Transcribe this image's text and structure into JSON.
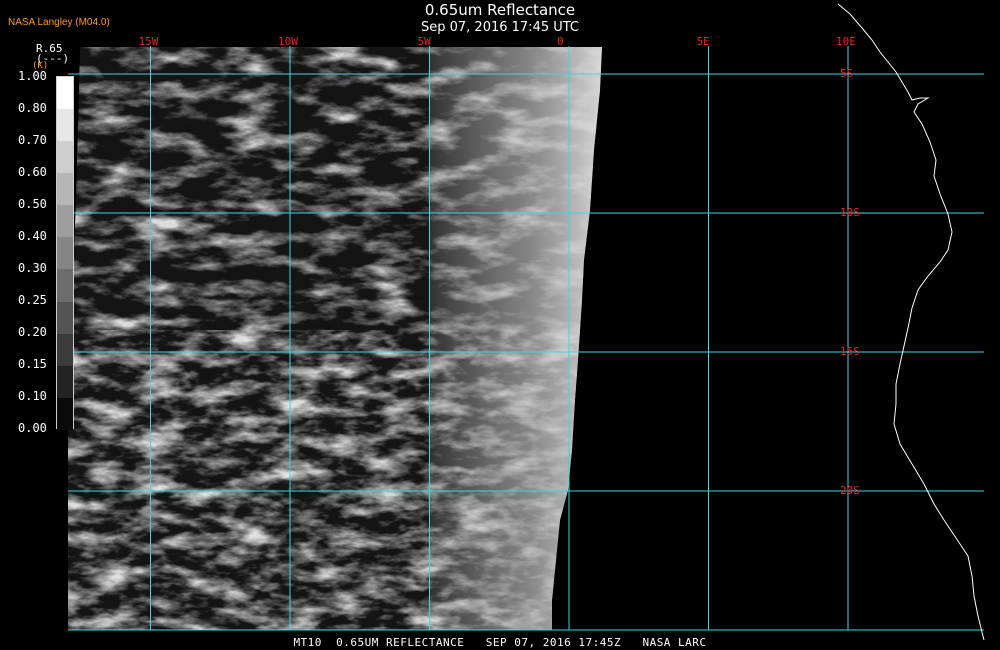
{
  "header": {
    "title": "0.65um Reflectance",
    "subtitle": "Sep 07, 2016 17:45 UTC",
    "producer": "NASA Langley (M04.0)"
  },
  "legend": {
    "variable": "R.65",
    "unit_line": "(---)",
    "unit": "(K)",
    "levels": [
      "1.00",
      "0.80",
      "0.70",
      "0.60",
      "0.50",
      "0.40",
      "0.30",
      "0.25",
      "0.20",
      "0.15",
      "0.10",
      "0.00"
    ]
  },
  "grid": {
    "longitudes": [
      {
        "label": "15W",
        "value": -15
      },
      {
        "label": "10W",
        "value": -10
      },
      {
        "label": "5W",
        "value": -5
      },
      {
        "label": "0",
        "value": 0
      },
      {
        "label": "5E",
        "value": 5
      },
      {
        "label": "10E",
        "value": 10
      }
    ],
    "latitudes": [
      {
        "label": "5S",
        "value": -5
      },
      {
        "label": "10S",
        "value": -10
      },
      {
        "label": "15S",
        "value": -15
      },
      {
        "label": "20S",
        "value": -20
      }
    ],
    "grid_color": "#3fd6e0",
    "label_color": "#e52626"
  },
  "footer": "MT10  0.65UM REFLECTANCE   SEP 07, 2016 17:45Z   NASA LARC"
}
